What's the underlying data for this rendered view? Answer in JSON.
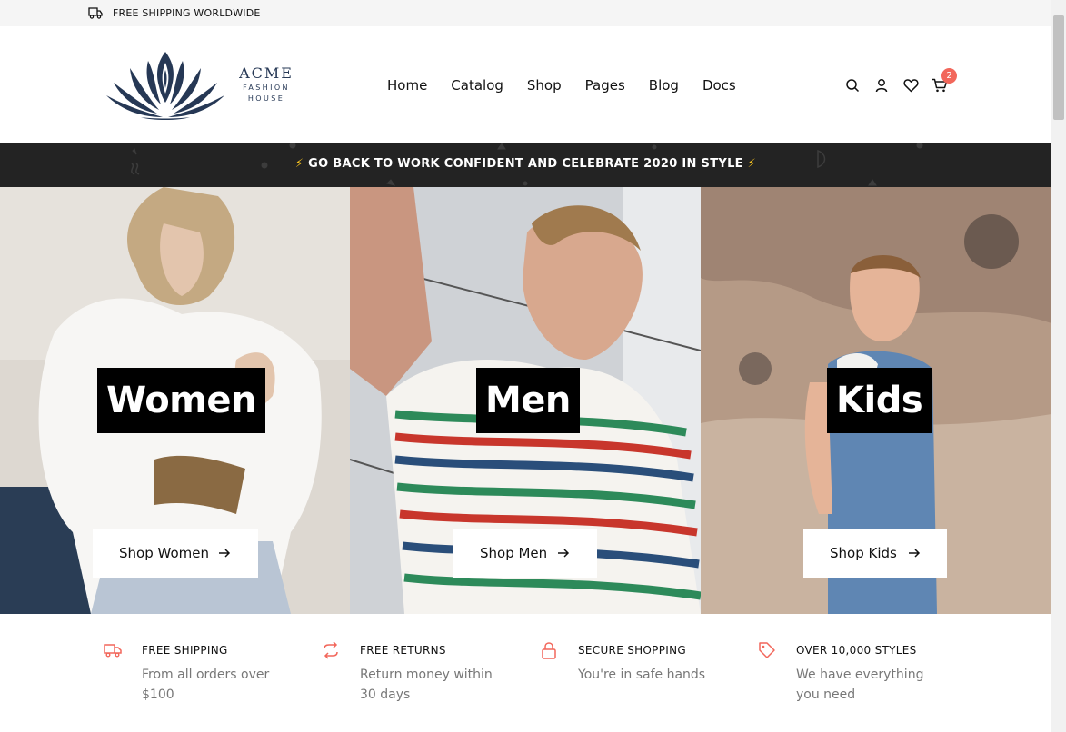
{
  "topbar": {
    "text": "FREE SHIPPING WORLDWIDE",
    "icon": "truck-icon"
  },
  "brand": {
    "name": "ACME",
    "line1": "FASHION",
    "line2": "HOUSE",
    "color": "#263855"
  },
  "nav": {
    "items": [
      "Home",
      "Catalog",
      "Shop",
      "Pages",
      "Blog",
      "Docs"
    ]
  },
  "header_icons": {
    "search": "search-icon",
    "account": "user-icon",
    "wishlist": "heart-icon",
    "cart": "cart-icon",
    "cart_count": "2"
  },
  "promo": {
    "bolt": "⚡",
    "text": "GO BACK TO WORK CONFIDENT AND CELEBRATE 2020 IN STYLE"
  },
  "categories": [
    {
      "title": "Women",
      "button": "Shop Women"
    },
    {
      "title": "Men",
      "button": "Shop Men"
    },
    {
      "title": "Kids",
      "button": "Shop Kids"
    }
  ],
  "features": [
    {
      "title": "FREE SHIPPING",
      "desc": "From all orders over $100",
      "icon": "truck-icon"
    },
    {
      "title": "FREE RETURNS",
      "desc": "Return money within 30 days",
      "icon": "return-arrows-icon"
    },
    {
      "title": "SECURE SHOPPING",
      "desc": "You're in safe hands",
      "icon": "lock-icon"
    },
    {
      "title": "OVER 10,000 STYLES",
      "desc": "We have everything you need",
      "icon": "tag-icon"
    }
  ],
  "colors": {
    "accent": "#f2675b",
    "dark": "#232323",
    "bolt": "#f7c320"
  }
}
